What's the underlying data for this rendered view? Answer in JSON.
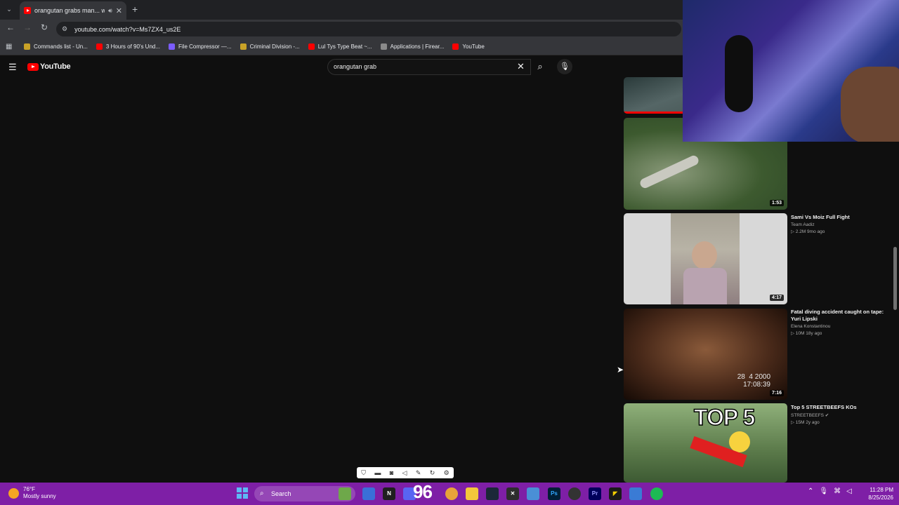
{
  "browser": {
    "tab_title": "orangutan grabs man... whe",
    "url": "youtube.com/watch?v=Ms7ZX4_us2E",
    "bookmarks": [
      {
        "label": "Commands list - Un...",
        "color": "#c9a227"
      },
      {
        "label": "3 Hours of 90's Und...",
        "color": "#ff0000"
      },
      {
        "label": "File Compressor —...",
        "color": "#7b5cff"
      },
      {
        "label": "Criminal Division -...",
        "color": "#c9a227"
      },
      {
        "label": "Lul Tys Type Beat ~...",
        "color": "#ff0000"
      },
      {
        "label": "Applications | Firear...",
        "color": "#8a8a8a"
      },
      {
        "label": "YouTube",
        "color": "#ff0000"
      }
    ]
  },
  "youtube": {
    "logo_text": "YouTube",
    "search_query": "orangutan grab"
  },
  "recommendations": [
    {
      "title": "",
      "channel": "",
      "stats": "",
      "duration": "1:53"
    },
    {
      "title": "Sami Vs Moiz Full Fight",
      "channel": "Team Aadiz",
      "stats": "▷ 2.2M  9mo ago",
      "duration": "4:17"
    },
    {
      "title": "Fatal diving accident caught on tape: Yuri Lipski",
      "channel": "Elena Konstantinou",
      "stats": "▷ 10M  18y ago",
      "duration": "7:16",
      "overlay_text": "28  4 2000\n17:08:39"
    },
    {
      "title": "Top 5 STREETBEEFS KOs",
      "channel": "STREETBEEFS ✔",
      "stats": "▷ 15M  2y ago",
      "duration": "",
      "overlay_text": "TOP 5"
    }
  ],
  "taskbar": {
    "temperature": "76°F",
    "weather": "Mostly sunny",
    "search_label": "Search",
    "badge": "96",
    "time": "11:28 PM",
    "date": "8/25/2026"
  },
  "icons": [
    "tab-list-icon",
    "speaker-icon",
    "close-icon",
    "new-tab-icon",
    "back-icon",
    "forward-icon",
    "reload-icon",
    "site-info-icon",
    "apps-icon",
    "hamburger-icon",
    "clear-icon",
    "search-icon",
    "mic-icon",
    "cursor-icon",
    "windows-start-icon"
  ]
}
